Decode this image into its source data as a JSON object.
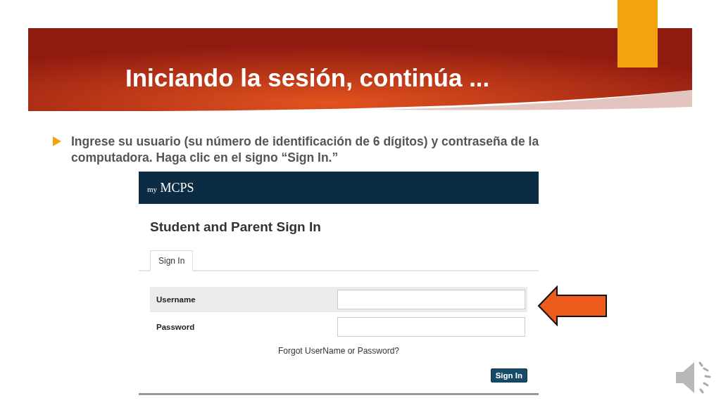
{
  "slide": {
    "title": "Iniciando la sesión, continúa ...",
    "bullets": [
      "Ingrese su usuario (su número de identificación de 6 dígitos) y contraseña de la computadora. Haga clic en el signo “Sign In.”"
    ]
  },
  "screenshot": {
    "logo": {
      "prefix": "my",
      "name": "MCPS"
    },
    "heading": "Student and Parent Sign In",
    "tabs": [
      {
        "label": "Sign In",
        "selected": true
      }
    ],
    "fields": [
      {
        "label": "Username",
        "highlighted": true
      },
      {
        "label": "Password",
        "highlighted": false
      }
    ],
    "forgot_link": "Forgot UserName or Password?",
    "submit": "Sign In"
  }
}
